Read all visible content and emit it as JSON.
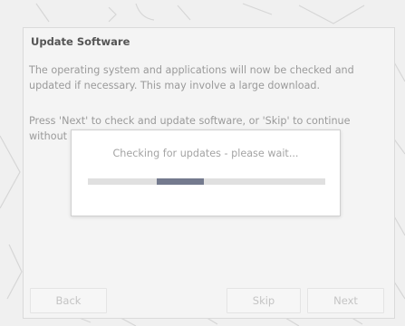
{
  "wizard": {
    "title": "Update Software",
    "paragraph1": "The operating system and applications will now be checked and updated if necessary. This may involve a large download.",
    "paragraph2": "Press 'Next' to check and update software, or 'Skip' to continue without",
    "buttons": {
      "back": "Back",
      "skip": "Skip",
      "next": "Next"
    }
  },
  "progress_dialog": {
    "message": "Checking for updates - please wait...",
    "indicator": {
      "start_fraction": 0.29,
      "end_fraction": 0.49,
      "fill_color": "#747a8e",
      "track_color": "#e0e0e0"
    }
  }
}
